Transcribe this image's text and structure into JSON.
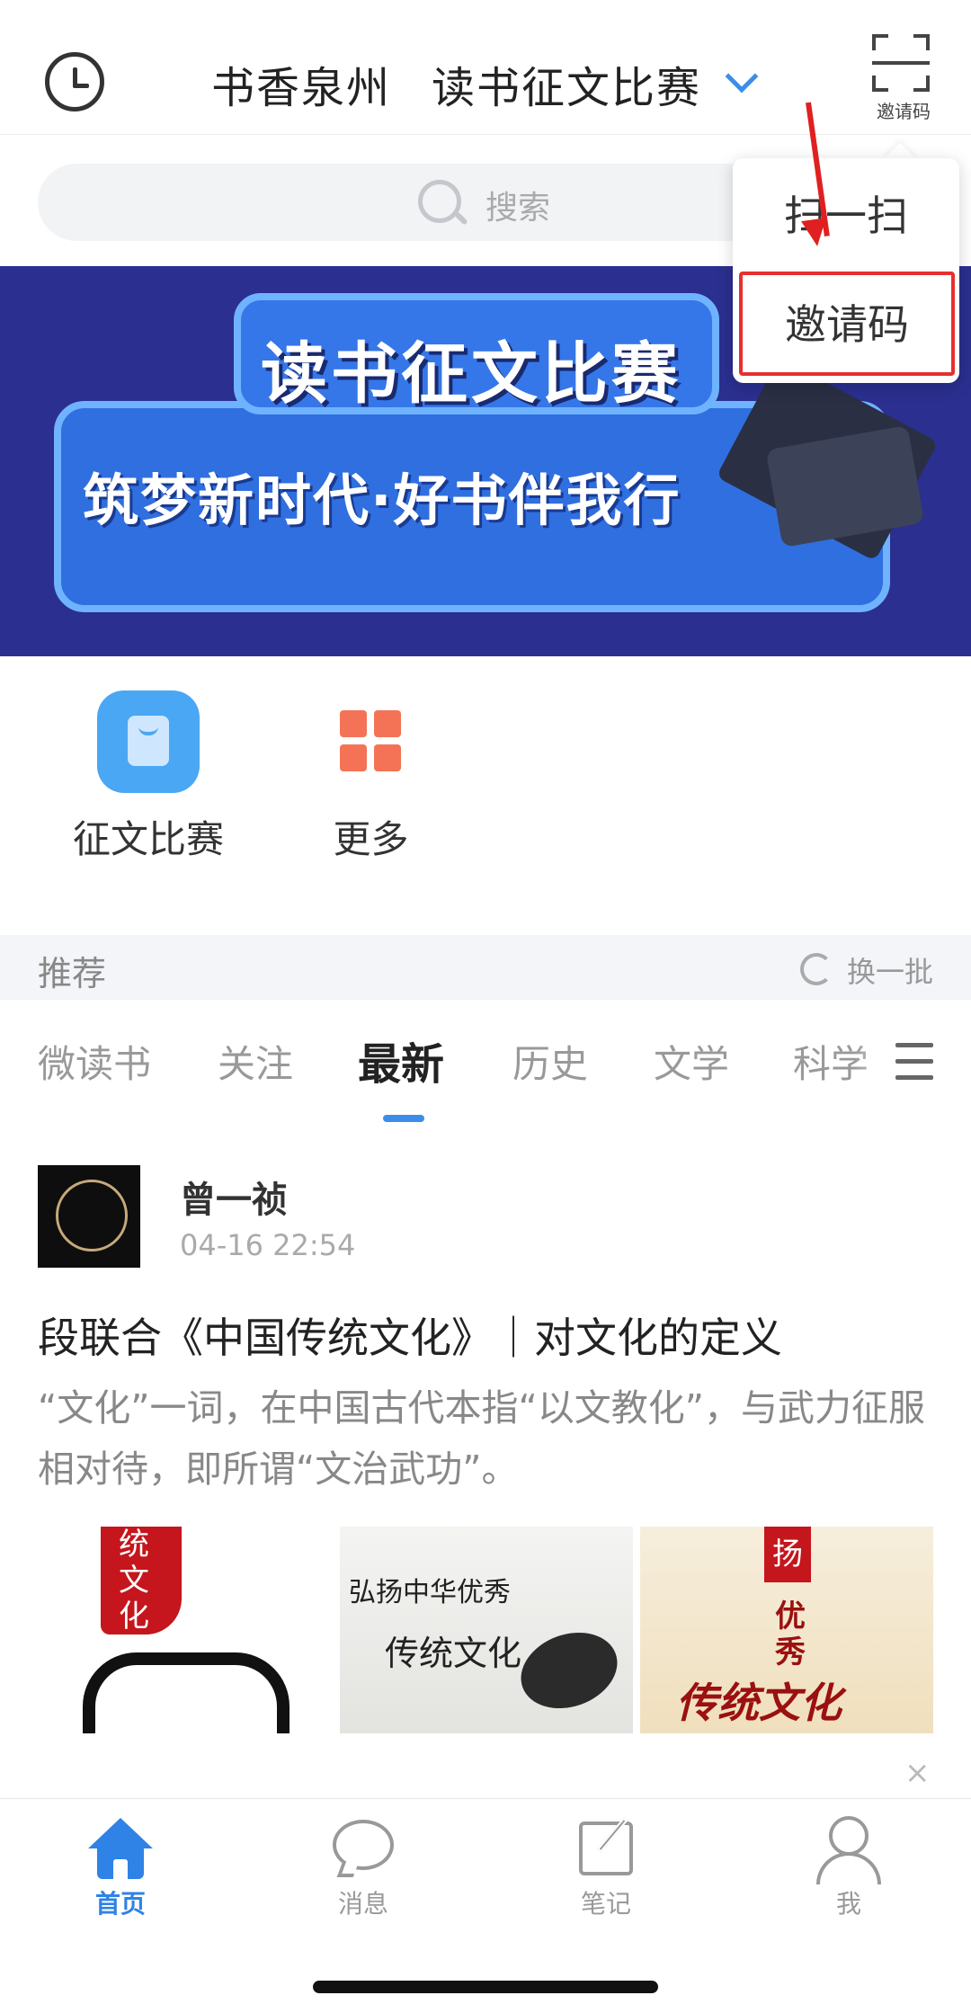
{
  "header": {
    "title_main": "书香泉州",
    "title_sub": "读书征文比赛",
    "scan_label": "邀请码"
  },
  "popup_menu": {
    "items": [
      "扫一扫",
      "邀请码"
    ]
  },
  "search": {
    "placeholder": "搜索"
  },
  "banner": {
    "title": "读书征文比赛",
    "slogan": "筑梦新时代·好书伴我行"
  },
  "quick_actions": [
    {
      "label": "征文比赛",
      "icon": "shopping-bag-icon",
      "color": "#4aa7f4"
    },
    {
      "label": "更多",
      "icon": "grid-icon",
      "color": "#f47356"
    }
  ],
  "recommend": {
    "title": "推荐",
    "refresh_label": "换一批"
  },
  "tabs": [
    "微读书",
    "关注",
    "最新",
    "历史",
    "文学",
    "科学"
  ],
  "active_tab": "最新",
  "post": {
    "author": "曾一祯",
    "time": "04-16 22:54",
    "title": "段联合《中国传统文化》｜对文化的定义",
    "excerpt": "“文化”一词，在中国古代本指“以文教化”，与武力征服相对待，即所谓“文治武功”。",
    "thumbs": [
      {
        "text": "统文化"
      },
      {
        "line1": "弘扬中华优秀",
        "line2": "传统文化"
      },
      {
        "seal": "扬",
        "line1": "优",
        "line2": "秀",
        "line3": "传统文化"
      }
    ],
    "close_symbol": "×"
  },
  "bottom_nav": [
    {
      "label": "首页",
      "icon": "home-icon",
      "active": true
    },
    {
      "label": "消息",
      "icon": "message-icon",
      "active": false
    },
    {
      "label": "笔记",
      "icon": "note-icon",
      "active": false
    },
    {
      "label": "我",
      "icon": "profile-icon",
      "active": false
    }
  ],
  "colors": {
    "accent": "#3b8ee8",
    "active_nav": "#2f82e6",
    "highlight_border": "#e63030",
    "banner_bg": "#2b2f8f"
  }
}
